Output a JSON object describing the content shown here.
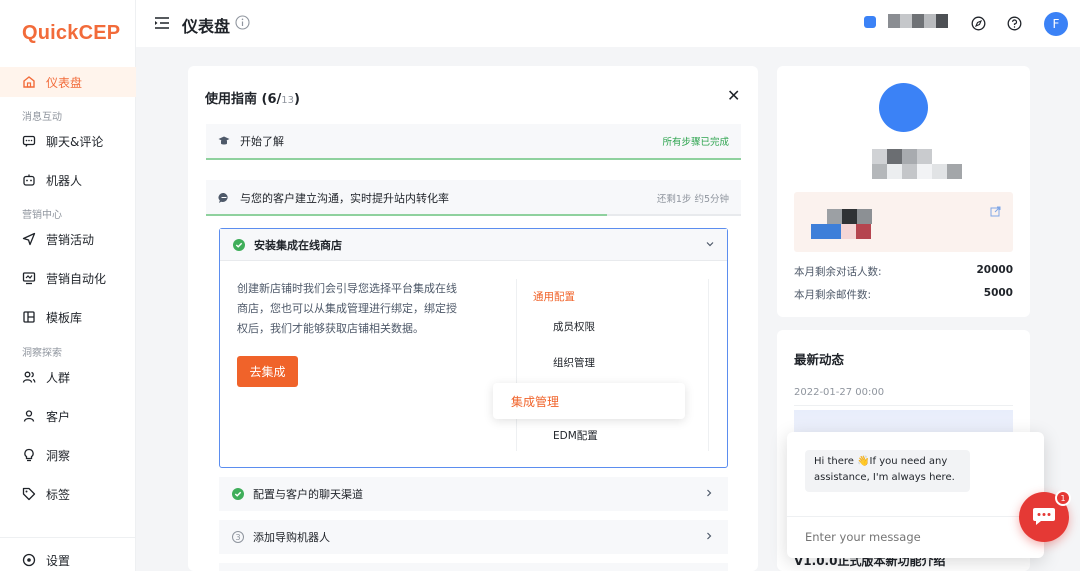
{
  "app": {
    "logo_text": "QuickCEP"
  },
  "sidebar": {
    "items": [
      {
        "label": "仪表盘",
        "icon": "home-icon"
      },
      {
        "section": "消息互动"
      },
      {
        "label": "聊天&评论",
        "icon": "chat-icon"
      },
      {
        "label": "机器人",
        "icon": "robot-icon"
      },
      {
        "section": "营销中心"
      },
      {
        "label": "营销活动",
        "icon": "send-icon"
      },
      {
        "label": "营销自动化",
        "icon": "automation-icon"
      },
      {
        "label": "模板库",
        "icon": "template-icon"
      },
      {
        "section": "洞察探索"
      },
      {
        "label": "人群",
        "icon": "people-icon"
      },
      {
        "label": "客户",
        "icon": "user-icon"
      },
      {
        "label": "洞察",
        "icon": "bulb-icon"
      },
      {
        "label": "标签",
        "icon": "tag-icon"
      },
      {
        "label": "设置",
        "icon": "settings-icon"
      }
    ],
    "active": "仪表盘"
  },
  "header": {
    "title": "仪表盘",
    "avatar_letter": "F"
  },
  "guide": {
    "title_prefix": "使用指南 (6/",
    "title_total": "13",
    "title_suffix": ")",
    "close": "✕",
    "step1": {
      "label": "开始了解",
      "status": "所有步骤已完成"
    },
    "step2": {
      "label": "与您的客户建立沟通，实时提升站内转化率",
      "status": "还剩1步 约5分钟",
      "progress": 0.75
    },
    "substep_open": {
      "label": "安装集成在线商店",
      "desc": "创建新店铺时我们会引导您选择平台集成在线商店，您也可以从集成管理进行绑定，绑定授权后，我们才能够获取店铺相关数据。",
      "button": "去集成",
      "menu_group": "通用配置",
      "menu_items": [
        "成员权限",
        "组织管理",
        "EDM配置"
      ],
      "menu_highlight": "集成管理"
    },
    "substep2": {
      "label": "配置与客户的聊天渠道"
    },
    "substep3": {
      "number": "3",
      "label": "添加导购机器人"
    }
  },
  "profile": {
    "stats": [
      {
        "label": "本月剩余对话人数:",
        "value": "20000"
      },
      {
        "label": "本月剩余邮件数:",
        "value": "5000"
      }
    ]
  },
  "news": {
    "title": "最新动态",
    "date": "2022-01-27 00:00",
    "headline": "V1.0.0正式版本新功能介绍"
  },
  "chat": {
    "greeting": "Hi there 👋If you need any assistance, I'm always here.",
    "placeholder": "Enter your message",
    "badge": "1"
  },
  "colors": {
    "brand": "#f26b3a",
    "primary_button": "#f0632a",
    "success": "#3fae5a",
    "accent_blue": "#3b82f6",
    "chat_red": "#e53935"
  }
}
